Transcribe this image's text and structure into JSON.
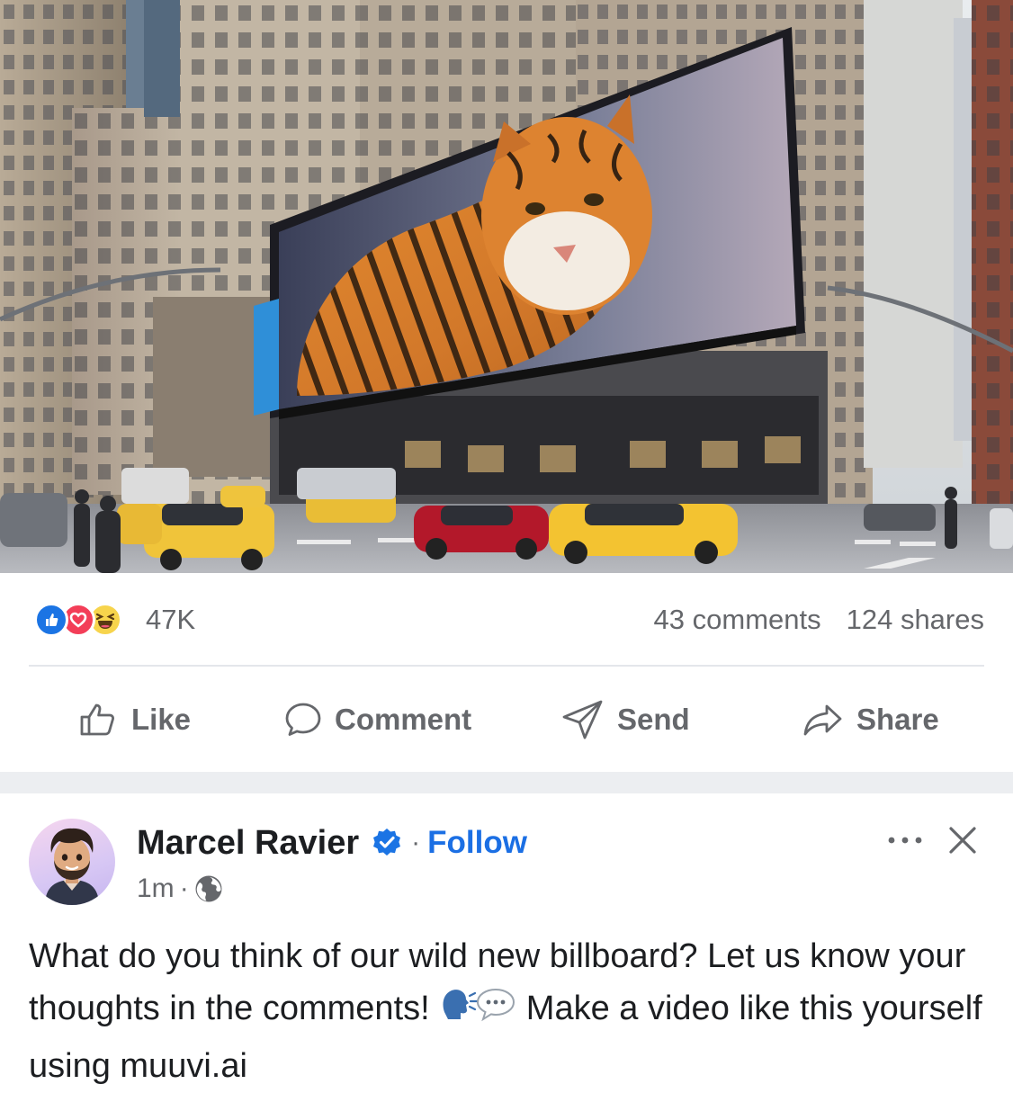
{
  "media": {
    "alt_icon": "tiger-billboard-city-photo"
  },
  "stats": {
    "reaction_icons": [
      "like-reaction-icon",
      "love-reaction-icon",
      "haha-reaction-icon"
    ],
    "reaction_count": "47K",
    "comments": "43 comments",
    "shares": "124 shares"
  },
  "actions": {
    "like": "Like",
    "comment": "Comment",
    "send": "Send",
    "share": "Share"
  },
  "post": {
    "author": "Marcel Ravier",
    "separator": "·",
    "follow": "Follow",
    "time": "1m",
    "time_separator": "·",
    "text_part1": "What do you think of our wild new billboard? Let us know your thoughts in the comments! ",
    "text_emojis": "🗣️💬",
    "text_part2": " Make a video like this yourself using muuvi.ai"
  },
  "colors": {
    "accent": "#1b6fe4",
    "secondary_text": "#65676b",
    "primary_text": "#1c1e21",
    "like_blue": "#1b74e4",
    "love_red": "#f33e58",
    "haha_yellow": "#f7d44c"
  }
}
